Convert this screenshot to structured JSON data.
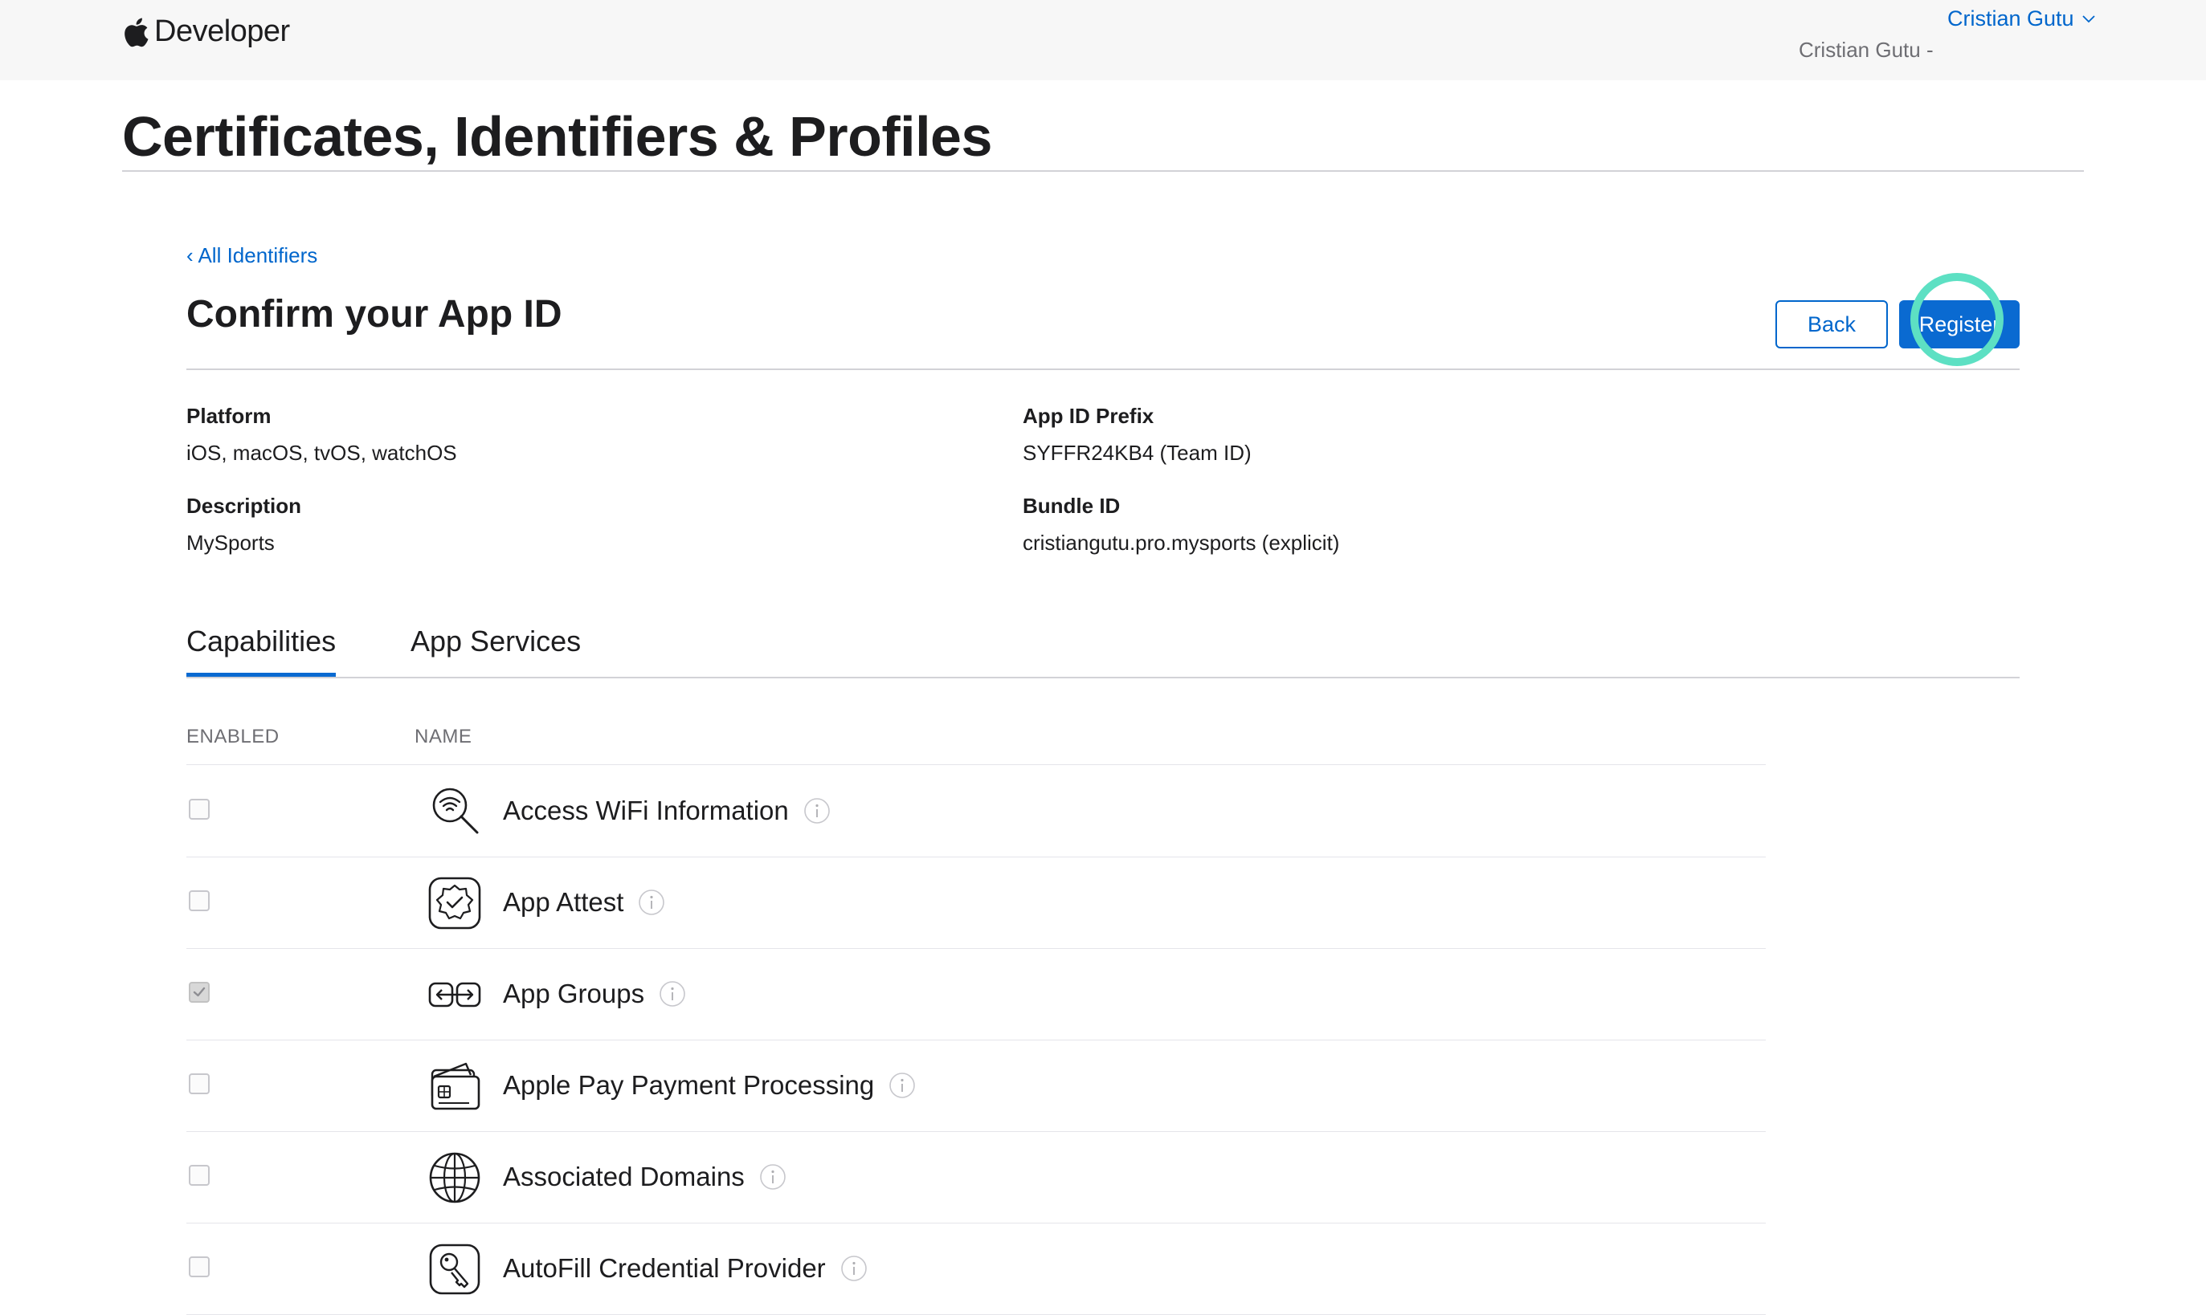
{
  "header": {
    "brand": "Developer",
    "user_name": "Cristian Gutu",
    "team_name": "Cristian Gutu -"
  },
  "page": {
    "title": "Certificates, Identifiers & Profiles"
  },
  "section": {
    "back_link": "‹ All Identifiers",
    "title": "Confirm your App ID",
    "back_button": "Back",
    "register_button": "Register"
  },
  "details": {
    "platform_label": "Platform",
    "platform_value": "iOS, macOS, tvOS, watchOS",
    "description_label": "Description",
    "description_value": "MySports",
    "prefix_label": "App ID Prefix",
    "prefix_value": "SYFFR24KB4 (Team ID)",
    "bundle_label": "Bundle ID",
    "bundle_value": "cristiangutu.pro.mysports (explicit)"
  },
  "tabs": [
    {
      "label": "Capabilities",
      "active": true
    },
    {
      "label": "App Services",
      "active": false
    }
  ],
  "table": {
    "col_enabled": "ENABLED",
    "col_name": "NAME",
    "rows": [
      {
        "name": "Access WiFi Information",
        "enabled": false,
        "icon": "wifi-search-icon"
      },
      {
        "name": "App Attest",
        "enabled": false,
        "icon": "badge-check-icon"
      },
      {
        "name": "App Groups",
        "enabled": true,
        "icon": "app-groups-icon"
      },
      {
        "name": "Apple Pay Payment Processing",
        "enabled": false,
        "icon": "credit-card-icon"
      },
      {
        "name": "Associated Domains",
        "enabled": false,
        "icon": "globe-icon"
      },
      {
        "name": "AutoFill Credential Provider",
        "enabled": false,
        "icon": "key-icon"
      }
    ]
  },
  "colors": {
    "accent": "#0066cc",
    "register_bg": "#0a6ad1",
    "highlight_ring": "#5de0c3",
    "header_bg": "#f7f7f7"
  }
}
